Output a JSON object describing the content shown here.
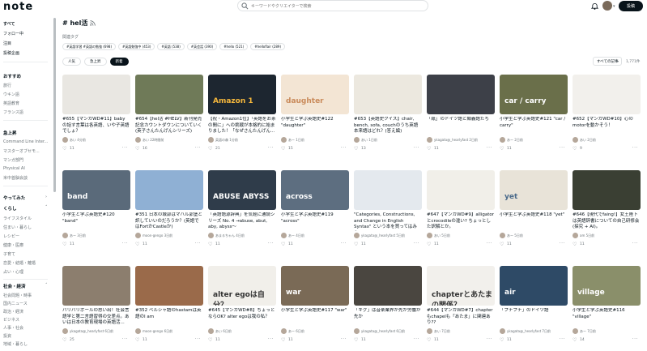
{
  "header": {
    "logo": "note",
    "search_placeholder": "キーワードやクリエイターで検索",
    "post_label": "投稿"
  },
  "sidebar": {
    "top": [
      {
        "label": "すべて"
      },
      {
        "label": "フォロー中"
      },
      {
        "label": "注目"
      },
      {
        "label": "投稿企画"
      }
    ],
    "recommend_title": "おすすめ",
    "recommend": [
      {
        "label": "旅行"
      },
      {
        "label": "ウキン語"
      },
      {
        "label": "英語教育"
      },
      {
        "label": "フランス語"
      }
    ],
    "featured_title": "急上昇",
    "featured": [
      {
        "label": "Command Line Inter..."
      },
      {
        "label": "マスターオブセモ..."
      },
      {
        "label": "マンガ部門"
      },
      {
        "label": "Physical AI"
      },
      {
        "label": "米中首脳会談"
      }
    ],
    "trymore_title": "やってみた",
    "life_title": "くらし",
    "life": [
      {
        "label": "ライフスタイル"
      },
      {
        "label": "住まい・暮らし"
      },
      {
        "label": "レシピー"
      },
      {
        "label": "健康・医療"
      },
      {
        "label": "子育て"
      },
      {
        "label": "恋愛・結婚・離婚"
      },
      {
        "label": "占い・心理"
      }
    ],
    "society_title": "社会・経済",
    "society": [
      {
        "label": "社会問題・時事"
      },
      {
        "label": "国内ニュース"
      },
      {
        "label": "政治・経済"
      },
      {
        "label": "ビジネス"
      },
      {
        "label": "人事・社会"
      },
      {
        "label": "投資"
      },
      {
        "label": "地域・暮らし"
      }
    ]
  },
  "main": {
    "title": "# hel活",
    "related_label": "関連タグ",
    "chips": [
      "#英語学習 #英語の勉強 (698)",
      "#英語勉強中 (453)",
      "#英語 (538)",
      "#英会話 (390)",
      "#hello (521)",
      "#helloflair (289)"
    ],
    "tabs": [
      "人気",
      "急上昇",
      "新着"
    ],
    "active_tab": 2,
    "sort_label": "すべての記事",
    "count_label": "1,771件"
  },
  "cards": [
    {
      "title": "#655【マンガWD#11】baby の話す言葉は各英語、いや子英語でしょ？",
      "author": "あい 4分前",
      "likes": "11",
      "thumb": "#e9e7e2",
      "label": "",
      "label_color": "#333"
    },
    {
      "title": "#654【hel活 #HELV】新刊発売記念カウントダウンについていく(英子さんたんげんシリーズ)",
      "author": "あい 22時間前",
      "likes": "16",
      "thumb": "#6f7a58",
      "label": "",
      "label_color": "#fff"
    },
    {
      "title": "【祝・Amazon1位】「英語をお茶の間に」への挑戦が本格的に始まりました！「なぜさんたんげん...",
      "author": "英語の森 1分前",
      "likes": "21",
      "thumb": "#1d2630",
      "label": "Amazon 1",
      "label_color": "#f5b73c"
    },
    {
      "title": "小学生と学ぶ英語史#122 \"daughter\"",
      "author": "あー 1日前",
      "likes": "15",
      "thumb": "#f3e5d4",
      "label": "daughter",
      "label_color": "#c98a5a"
    },
    {
      "title": "#653【英語史クイズ】chair, bench, sofa, couchのうち英語本来語はどれ？(答え編)",
      "author": "あい 1日前",
      "likes": "13",
      "thumb": "#ece8df",
      "label": "",
      "label_color": "#333"
    },
    {
      "title": "「紙」のドイツ語と類義語たち",
      "author": "ykagata@_hearlyfast 2日前",
      "likes": "11",
      "thumb": "#3d4048",
      "label": "",
      "label_color": "#fff"
    },
    {
      "title": "小学生と学ぶ英語史#121 \"car / carry\"",
      "author": "あー 2日前",
      "likes": "11",
      "thumb": "#6a6f4a",
      "label": "car / carry",
      "label_color": "#fff"
    },
    {
      "title": "#652【マンガWD#10】心のmotorを動かそう！",
      "author": "あい 2日前",
      "likes": "9",
      "thumb": "#f2f0ec",
      "label": "",
      "label_color": "#333"
    },
    {
      "title": "小学生と学ぶ英語史#120 \"band\"",
      "author": "あー 3日前",
      "likes": "11",
      "thumb": "#5a6a7a",
      "label": "band",
      "label_color": "#fff"
    },
    {
      "title": "#351 日本の城郭はマハル郭堡と訳していいのだろうか？(英語ではFortかCastleか)",
      "author": "moon-gengo 3日前",
      "likes": "11",
      "thumb": "#8fb0d4",
      "label": "",
      "label_color": "#fff"
    },
    {
      "title": "「英語語源辞典」を気軽に通読シリーズ No. 4 →abuse, abut, aby, abyss～",
      "author": "あまるちゃん 4日前",
      "likes": "11",
      "thumb": "#2f3c4a",
      "label": "ABUSE ABYSS",
      "label_color": "#fff"
    },
    {
      "title": "小学生と学ぶ英語史#119 \"across\"",
      "author": "あー 4日前",
      "likes": "11",
      "thumb": "#5d6e80",
      "label": "across",
      "label_color": "#fff"
    },
    {
      "title": "\"Categories, Constructions, and Change in English Syntax\" という本を買ってはみた...",
      "author": "ykagata@_hearlyfast 5日前",
      "likes": "11",
      "thumb": "#e4e9ee",
      "label": "",
      "label_color": "#333"
    },
    {
      "title": "#647【マンガWD#9】alligatorとcrocodileの違い? ちょっとした訳解とか。",
      "author": "あい 5日前",
      "likes": "11",
      "thumb": "#f1efe9",
      "label": "",
      "label_color": "#333"
    },
    {
      "title": "小学生と学ぶ英語史#118 \"yet\"",
      "author": "あー 5日前",
      "likes": "11",
      "thumb": "#e8e3d8",
      "label": "yet",
      "label_color": "#4a6a8a"
    },
    {
      "title": "#646【現代でfaing!】女王陛下は英語辞書についての自己研修会(探究 + AI)。",
      "author": "am 5日前",
      "likes": "11",
      "thumb": "#3a3f33",
      "label": "",
      "label_color": "#fff"
    },
    {
      "title": "バリバリポールの思い出！社会言語学と第二言語習得の交差点。あいは日本の教育現場の英語活...",
      "author": "ykagata@_hearlyfast 6日前",
      "likes": "25",
      "thumb": "#8c7e6e",
      "label": "",
      "label_color": "#fff"
    },
    {
      "title": "#352 ベルシャ語のhastamは英語のI am",
      "author": "moon-gengo 6日前",
      "likes": "11",
      "thumb": "#9a6a4a",
      "label": "",
      "label_color": "#fff"
    },
    {
      "title": "#645【マンガWD#8】ちょっとならOK? alter egoは我の私？",
      "author": "あい 6日前",
      "likes": "11",
      "thumb": "#f1efea",
      "label": "alter egoは自分？",
      "label_color": "#333"
    },
    {
      "title": "小学生と学ぶ英語史#117 \"war\"",
      "author": "あー 6日前",
      "likes": "11",
      "thumb": "#7a6a56",
      "label": "war",
      "label_color": "#fff"
    },
    {
      "title": "「ギグ」は音楽業界が先か労働が先か",
      "author": "ykagata@_hearlyfast 6日前",
      "likes": "11",
      "thumb": "#4a4640",
      "label": "",
      "label_color": "#fff"
    },
    {
      "title": "#644【マンガWD#7】chapterもchapelも「あたま」に関連あり??",
      "author": "あい 7日前",
      "likes": "11",
      "thumb": "#f2f0ec",
      "label": "chapterとあたまの関係？",
      "label_color": "#333"
    },
    {
      "title": "「プチプチ」のドイツ語",
      "author": "ykagata@_hearlyfast 7日前",
      "likes": "11",
      "thumb": "#2e4a66",
      "label": "air",
      "label_color": "#fff"
    },
    {
      "title": "小学生と学ぶ英語史#116 \"village\"",
      "author": "あー 7日前",
      "likes": "14",
      "thumb": "#8a8f6a",
      "label": "village",
      "label_color": "#fff"
    }
  ]
}
